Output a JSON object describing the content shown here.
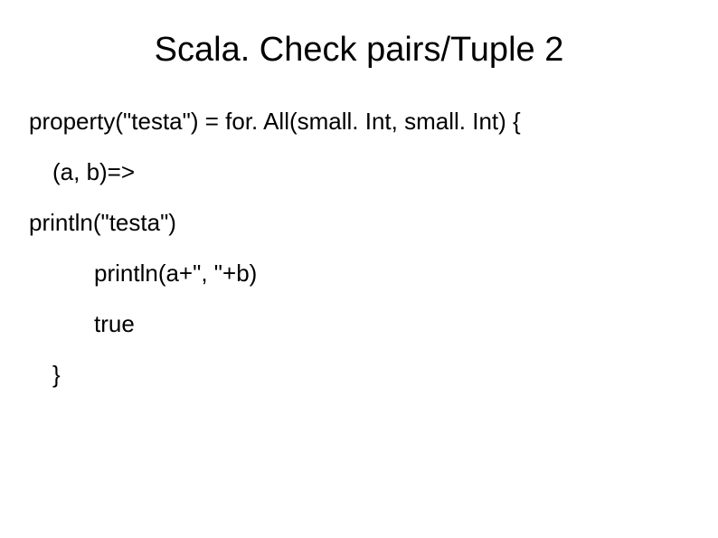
{
  "title": "Scala. Check pairs/Tuple 2",
  "code": {
    "l1": "property(\"testa\") = for. All(small. Int, small. Int) {",
    "l2": "(a, b)=>",
    "l3": "println(\"testa\")",
    "l4": "println(a+\", \"+b)",
    "l5": "true",
    "l6": "}"
  }
}
